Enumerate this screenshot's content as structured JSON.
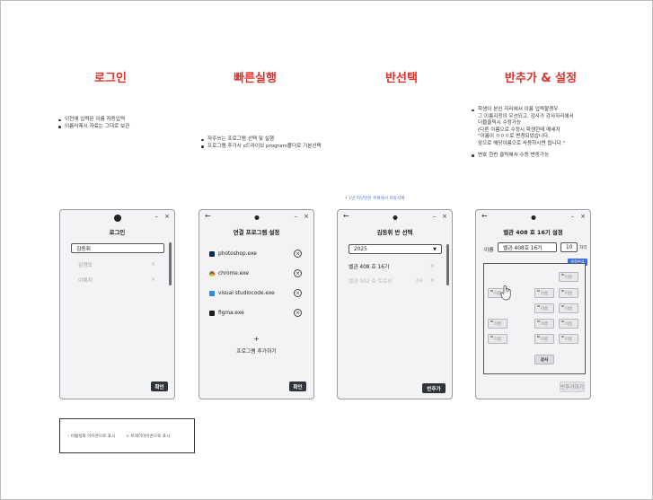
{
  "headings": {
    "login": "로그인",
    "quick_run": "빠른실행",
    "class_select": "반선택",
    "extract_settings": "반추가 & 설정"
  },
  "notes": {
    "login": [
      "이전에 입력된 이름 자동입력",
      "이름삭제시 자료는 그대로 보관"
    ],
    "quick_run": [
      "자주쓰는 프로그램 선택 및 실행",
      "프로그램 추가시 c드라이브 program폴더로 기본선택"
    ],
    "settings": {
      "bullet1": "학생이 본인 자리에서 이름 입력할경우",
      "lines": [
        "그 이름지정이 우선되고, 강사가 강사자리에서",
        "더블클릭시 수정가능",
        "(다른 이름으로 수정시 학생한테 메세지",
        "\"이름이 ㅇㅇㅇ로 변경되었습니다.",
        "앞으로 해당이름으로 사용하시면 됩니다.\""
      ],
      "bullet2": "변호 한번 클릭해서 수동 변동가능"
    },
    "class_select_tiny": "• 1년 지난반은 목록에서 자동삭제"
  },
  "window_controls": {
    "minimize": "–",
    "close": "×",
    "back": "←"
  },
  "login_window": {
    "title": "로그인",
    "current_name": "김동휘",
    "saved_names": [
      "김경모",
      "이예지"
    ],
    "delete_icon": "×",
    "confirm_button": "확인"
  },
  "quick_window": {
    "title": "연결 프로그램 설정",
    "programs": [
      {
        "name": "photoshop.exe",
        "icon": "photoshop-icon",
        "color": "#0b2a55"
      },
      {
        "name": "chrome.exe",
        "icon": "chrome-icon",
        "color": "#e8a21b"
      },
      {
        "name": "visual studiocode.exe",
        "icon": "vscode-icon",
        "color": "#2a8be8"
      },
      {
        "name": "figma.exe",
        "icon": "figma-icon",
        "color": "#1e1e1e"
      }
    ],
    "remove_icon": "×",
    "add_icon": "+",
    "add_label": "프로그램 추가하기",
    "confirm_button": "확인"
  },
  "class_window": {
    "title": "김동휘 반 선택",
    "year": "2025",
    "classes": [
      {
        "name": "벨관 408 호 16기",
        "note": "",
        "active": true
      },
      {
        "name": "벨관 502 호 토토상",
        "note": "종료",
        "active": false
      }
    ],
    "delete_icon": "×",
    "extract_button": "반추가"
  },
  "settings_window": {
    "title": "벨관 408 호 16기 설정",
    "name_label": "이름",
    "name_value": "벨관 408호 16기",
    "seat_count": "10",
    "seat_unit": "자리",
    "settings_badge": "설정완료",
    "seat_label": "이름",
    "teacher_label": "강사",
    "confirm_button": "반추가하기"
  },
  "legend": {
    "minimize": "비활성화 아이콘으로 표시",
    "close": "트레이아이콘으로 표시"
  },
  "colors": {
    "heading": "#e0302a",
    "dark_button": "#2f333a",
    "accent_blue": "#3a6fd8"
  }
}
